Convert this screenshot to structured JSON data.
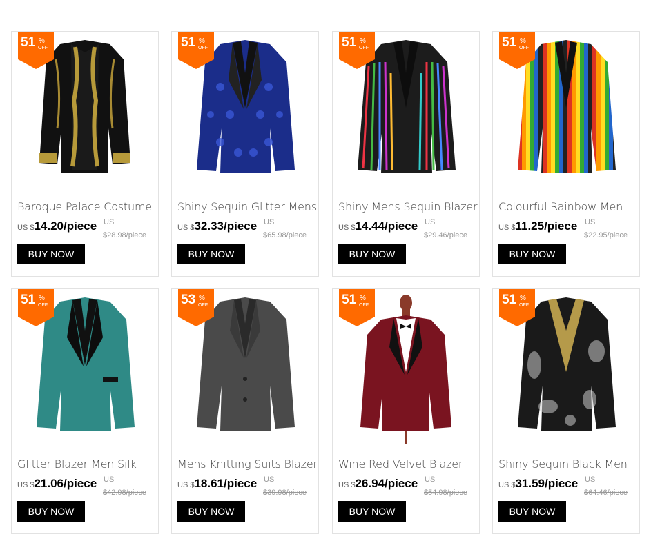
{
  "products": [
    {
      "discount": "51",
      "title": "Baroque Palace Costume",
      "currency": "US $",
      "price": "14.20",
      "unit": "/piece",
      "old_currency": "US",
      "old_price": "$28.98/piece",
      "button": "BUY NOW",
      "jacket": "black-gold-embroidered"
    },
    {
      "discount": "51",
      "title": "Shiny Sequin Glitter Mens",
      "currency": "US $",
      "price": "32.33",
      "unit": "/piece",
      "old_currency": "US",
      "old_price": "$65.98/piece",
      "button": "BUY NOW",
      "jacket": "blue-sequin"
    },
    {
      "discount": "51",
      "title": "Shiny Mens Sequin Blazer",
      "currency": "US $",
      "price": "14.44",
      "unit": "/piece",
      "old_currency": "US",
      "old_price": "$29.46/piece",
      "button": "BUY NOW",
      "jacket": "rainbow-sequin"
    },
    {
      "discount": "51",
      "title": "Colourful Rainbow Men",
      "currency": "US $",
      "price": "11.25",
      "unit": "/piece",
      "old_currency": "US",
      "old_price": "$22.95/piece",
      "button": "BUY NOW",
      "jacket": "rainbow-stripes"
    },
    {
      "discount": "51",
      "title": "Glitter Blazer Men Silk",
      "currency": "US $",
      "price": "21.06",
      "unit": "/piece",
      "old_currency": "US",
      "old_price": "$42.98/piece",
      "button": "BUY NOW",
      "jacket": "teal-glitter"
    },
    {
      "discount": "53",
      "title": "Mens Knitting Suits Blazers",
      "currency": "US $",
      "price": "18.61",
      "unit": "/piece",
      "old_currency": "US",
      "old_price": "$39.98/piece",
      "button": "BUY NOW",
      "jacket": "grey-knit"
    },
    {
      "discount": "51",
      "title": "Wine Red Velvet Blazer",
      "currency": "US $",
      "price": "26.94",
      "unit": "/piece",
      "old_currency": "US",
      "old_price": "$54.98/piece",
      "button": "BUY NOW",
      "jacket": "wine-red-velvet"
    },
    {
      "discount": "51",
      "title": "Shiny Sequin Black Men",
      "currency": "US $",
      "price": "31.59",
      "unit": "/piece",
      "old_currency": "US",
      "old_price": "$64.46/piece",
      "button": "BUY NOW",
      "jacket": "black-gold-sequin"
    }
  ],
  "badge": {
    "percent": "%",
    "off": "OFF",
    "color": "#ff6a00"
  }
}
